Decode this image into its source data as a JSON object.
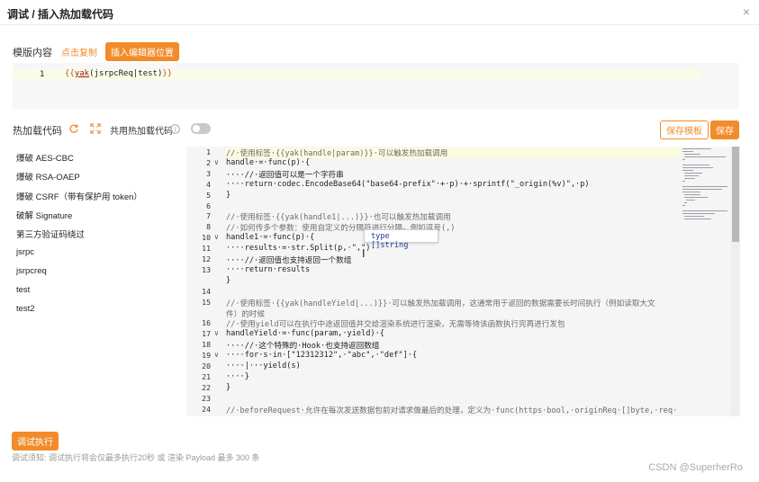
{
  "dialog": {
    "title": "调试 / 插入热加载代码",
    "close_glyph": "×"
  },
  "template": {
    "label": "模版内容",
    "copy_link": "点击复制",
    "insert_button": "插入编辑器位置",
    "line_number": "1",
    "code_prefix": "{{",
    "code_yak": "yak",
    "code_rest": "(jsrpcReq|test)",
    "code_suffix": "}}"
  },
  "hotload": {
    "label": "热加载代码",
    "shared_label": "共用热加载代码",
    "info_glyph": "i",
    "shared_enabled": false,
    "save_template_button": "保存模板",
    "save_button": "保存"
  },
  "sidebar": {
    "items": [
      {
        "label": "爆破 AES-CBC"
      },
      {
        "label": "爆破 RSA-OAEP"
      },
      {
        "label": "爆破 CSRF（带有保护用 token）"
      },
      {
        "label": "破解 Signature"
      },
      {
        "label": "第三方验证码绕过"
      },
      {
        "label": "jsrpc"
      },
      {
        "label": "jsrpcreq"
      },
      {
        "label": "test"
      },
      {
        "label": "test2"
      }
    ]
  },
  "editor": {
    "lines": [
      {
        "n": "1",
        "fold": "",
        "text": "//·使用标签·{{yak(handle|param)}}·可以触发热加载调用"
      },
      {
        "n": "2",
        "fold": "∨",
        "text": "handle·=·func(p)·{"
      },
      {
        "n": "3",
        "fold": "",
        "text": "····//·返回值可以是一个字符串"
      },
      {
        "n": "4",
        "fold": "",
        "text": "····return·codec.EncodeBase64(\"base64-prefix\"·+·p)·+·sprintf(\"_origin(%v)\",·p)"
      },
      {
        "n": "5",
        "fold": "",
        "text": "}"
      },
      {
        "n": "6",
        "fold": "",
        "text": ""
      },
      {
        "n": "7",
        "fold": "",
        "text": "//·使用标签·{{yak(handle1|...)}}·也可以触发热加载调用"
      },
      {
        "n": "8",
        "fold": "",
        "text": "//·如何传多个参数：使用自定义的分隔符进行分隔，例如逗号(,)"
      },
      {
        "n": "10",
        "fold": "∨",
        "text": "handle1·=·func(p)·{"
      },
      {
        "n": "11",
        "fold": "",
        "text": "····results·=·str.Split(p,·\",\")"
      },
      {
        "n": "12",
        "fold": "",
        "text": "····//·返回值也支持返回一个数组"
      },
      {
        "n": "13",
        "fold": "",
        "text": "····return·results"
      },
      {
        "n": "",
        "fold": "",
        "text": "}"
      },
      {
        "n": "14",
        "fold": "",
        "text": ""
      },
      {
        "n": "15",
        "fold": "",
        "text": "//·使用标签·{{yak(handleYield|...)}}·可以触发热加载调用，这通常用于返回的数据需要长时间执行（例如读取大文"
      },
      {
        "n": "",
        "fold": "",
        "text": "件）的时候"
      },
      {
        "n": "16",
        "fold": "",
        "text": "//·使用yield可以在执行中途返回值并交给渲染系统进行渲染，无需等待该函数执行完再进行发包"
      },
      {
        "n": "17",
        "fold": "∨",
        "text": "handleYield·=·func(param,·yield)·{"
      },
      {
        "n": "18",
        "fold": "",
        "text": "····//·这个特殊的·Hook·也支持返回数组"
      },
      {
        "n": "19",
        "fold": "∨",
        "text": "····for·s·in·[\"12312312\",·\"abc\",·\"def\"]·{"
      },
      {
        "n": "20",
        "fold": "",
        "text": "····|···yield(s)"
      },
      {
        "n": "21",
        "fold": "",
        "text": "····}"
      },
      {
        "n": "22",
        "fold": "",
        "text": "}"
      },
      {
        "n": "23",
        "fold": "",
        "text": ""
      },
      {
        "n": "24",
        "fold": "",
        "text": "//·beforeRequest·允许在每次发送数据包前对请求做最后的处理，定义为·func(https·bool,·originReq·[]byte,·req·"
      }
    ],
    "tooltip": "type   []string"
  },
  "footer": {
    "debug_button": "调试执行",
    "note": "调试须知: 调试执行将会仅最多执行20秒 或 渲染 Payload 最多 300 条",
    "watermark": "CSDN @SuperherRo"
  },
  "colors": {
    "accent": "#f28b2a",
    "editor_bg": "#f5f5f5",
    "line_highlight": "#fbfbe0"
  }
}
